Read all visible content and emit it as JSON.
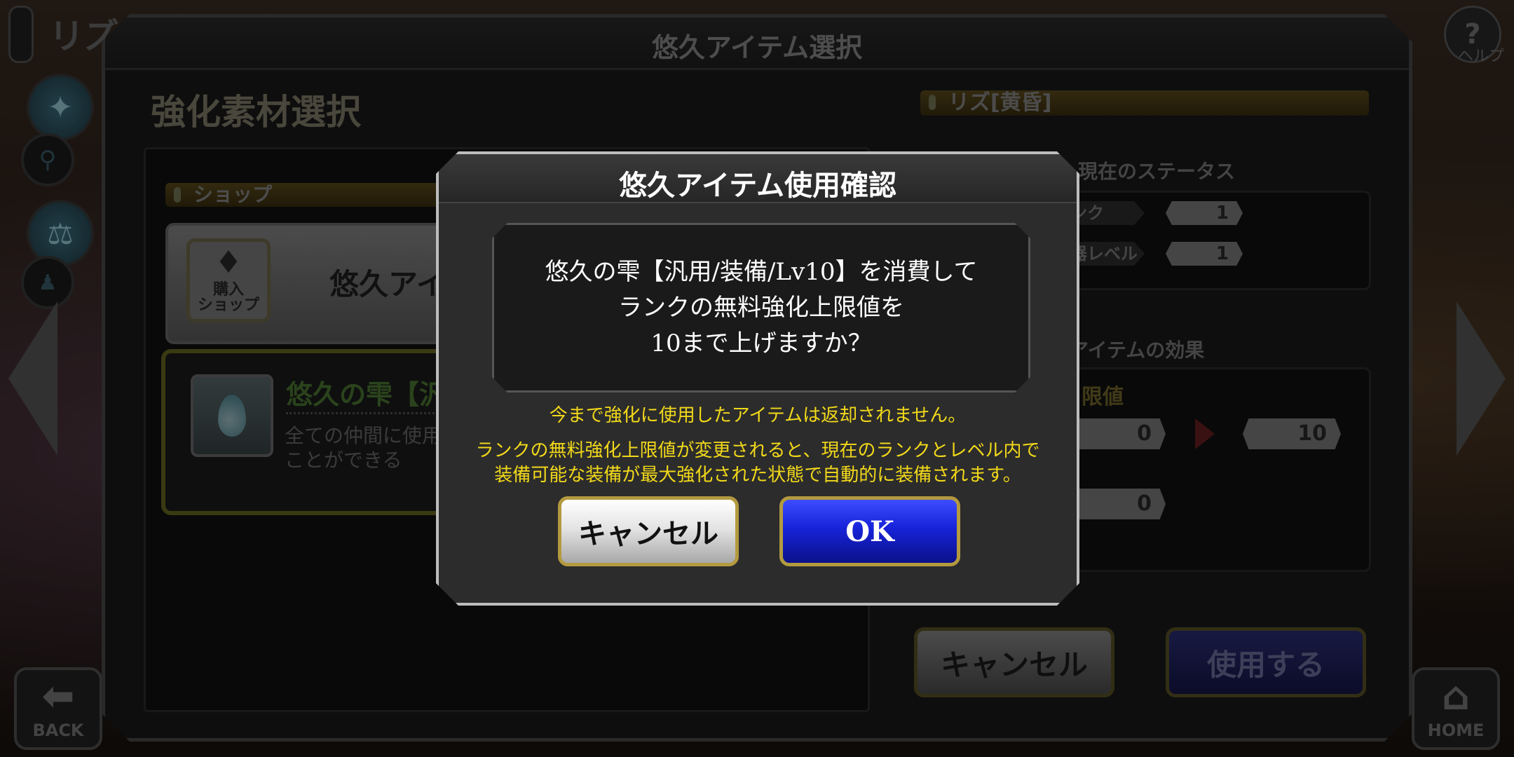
{
  "top": {
    "char_title": "リズ",
    "help_label": "ヘルプ"
  },
  "nav": {
    "back_label": "BACK",
    "home_label": "HOME"
  },
  "main": {
    "title": "悠久アイテム選択",
    "section_title": "強化素材選択",
    "shop_header": "ショップ",
    "shop_button_label": "購入\nショップ",
    "shop_name": "悠久アイ",
    "item_name": "悠久の雫【汎",
    "item_desc_line1": "全ての仲間に使用",
    "item_desc_line2": "ことができる"
  },
  "right": {
    "char_name": "リズ[黄昏]",
    "status_title": "現在のステータス",
    "rank_label": "ランク",
    "rank_value": "1",
    "weapon_level_label": "武器レベル",
    "weapon_level_value": "1",
    "effect_title": "アイテムの効果",
    "effect_sub": "限値",
    "effect_from": "0",
    "effect_to": "10",
    "effect_second": "0"
  },
  "main_buttons": {
    "cancel": "キャンセル",
    "use": "使用する"
  },
  "dialog": {
    "title": "悠久アイテム使用確認",
    "message_lines": [
      "悠久の雫【汎用/装備/Lv10】を消費して",
      "ランクの無料強化上限値を",
      "10まで上げますか？"
    ],
    "warning1": "今まで強化に使用したアイテムは返却されません。",
    "warning2_line1": "ランクの無料強化上限値が変更されると、現在のランクとレベル内で",
    "warning2_line2": "装備可能な装備が最大強化された状態で自動的に装備されます。",
    "cancel_label": "キャンセル",
    "ok_label": "OK"
  },
  "colors": {
    "ok_blue": "#1723d8",
    "warning_yellow": "#f2d91a",
    "item_green": "#4e7a33"
  }
}
